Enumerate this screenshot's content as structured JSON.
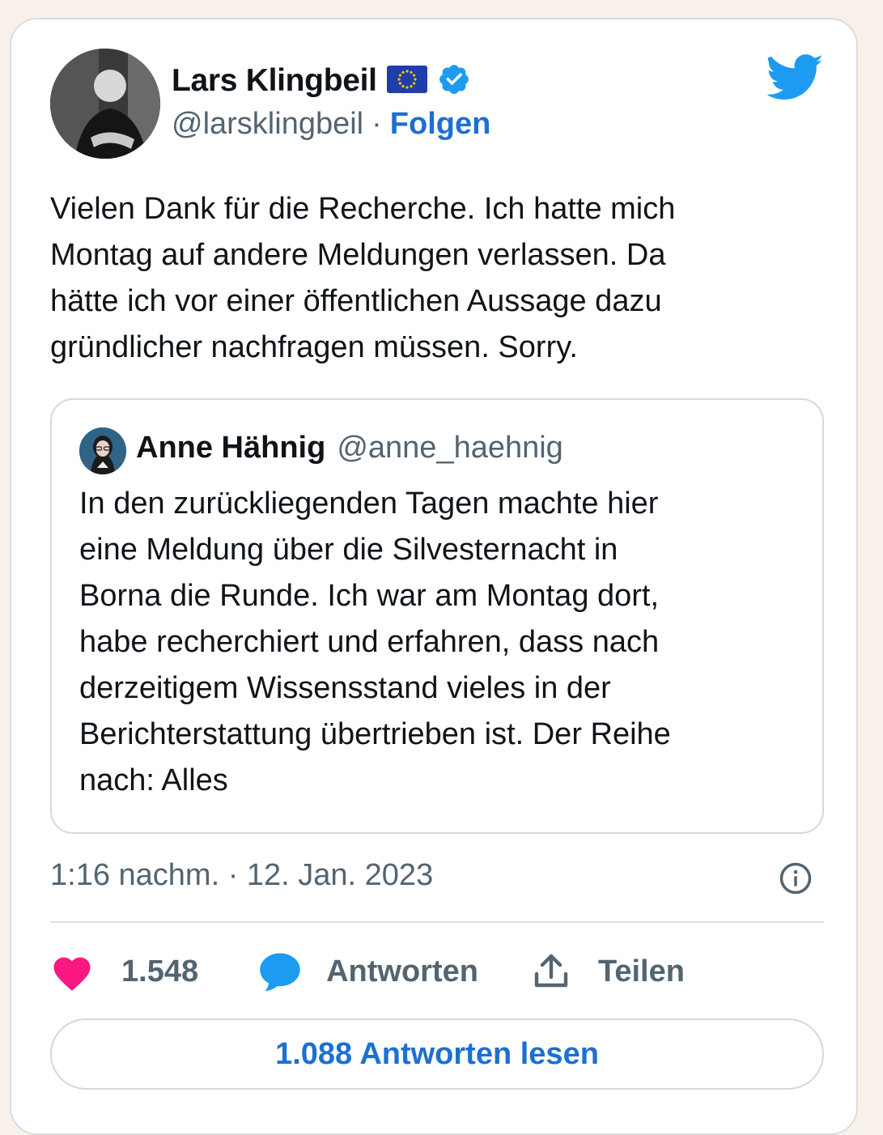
{
  "author": {
    "name": "Lars Klingbeil",
    "handle": "@larsklingbeil",
    "separator": "·",
    "follow_label": "Folgen"
  },
  "tweet": {
    "text": "Vielen Dank für die Recherche. Ich hatte mich\nMontag auf andere Meldungen verlassen. Da\nhätte ich vor einer öffentlichen Aussage dazu\ngründlicher nachfragen müssen. Sorry."
  },
  "quoted_tweet": {
    "name": "Anne Hähnig",
    "handle": "@anne_haehnig",
    "text": "In den zurückliegenden Tagen machte hier\neine Meldung über die Silvesternacht in\nBorna die Runde. Ich war am Montag dort,\nhabe recherchiert und erfahren, dass nach\nderzeitigem Wissensstand vieles in der\nBerichterstattung übertrieben ist. Der Reihe\nnach: Alles"
  },
  "timestamp": "1:16 nachm. · 12. Jan. 2023",
  "actions": {
    "likes": "1.548",
    "reply_label": "Antworten",
    "share_label": "Teilen"
  },
  "read_replies_label": "1.088 Antworten lesen",
  "icons": {
    "platform": "twitter-bird-icon",
    "flag": "eu-flag-icon",
    "verified": "verified-badge-icon",
    "info": "info-icon",
    "like": "heart-icon",
    "reply": "speech-bubble-icon",
    "share": "share-icon"
  },
  "colors": {
    "accent": "#1d6fd2",
    "twitter_blue": "#1d9bf0",
    "like": "#f91880",
    "muted_text": "#536471",
    "background": "#f8f1ea"
  }
}
